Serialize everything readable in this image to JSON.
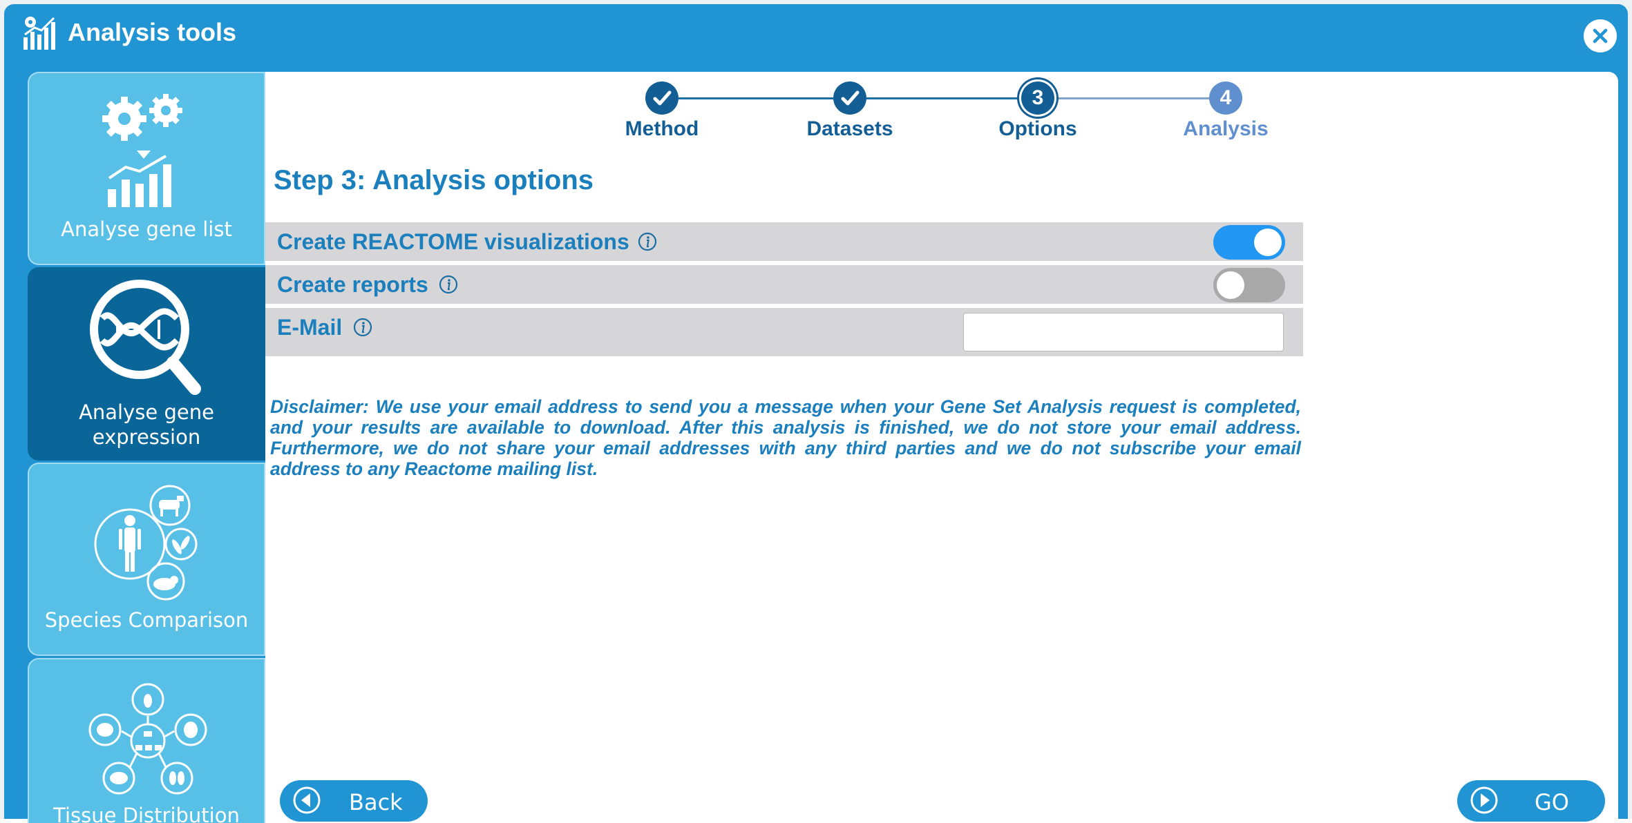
{
  "window": {
    "title": "Analysis tools",
    "logo_icon": "chart-logo-icon",
    "close_icon": "close-icon"
  },
  "colors": {
    "accent": "#2195d3",
    "sidebar_inactive": "#58c0e6",
    "sidebar_active": "#0a6599",
    "text_blue": "#1b7fbd",
    "toggle_on": "#2196f3",
    "toggle_off": "#a9a9a9"
  },
  "sidebar": {
    "items": [
      {
        "label": "Analyse gene list",
        "icon": "gears-chart-icon",
        "active": false
      },
      {
        "label_line1": "Analyse gene",
        "label_line2": "expression",
        "icon": "dna-magnifier-icon",
        "active": true
      },
      {
        "label": "Species Comparison",
        "icon": "species-icon",
        "active": false
      },
      {
        "label": "Tissue Distribution",
        "icon": "tissue-network-icon",
        "active": false
      }
    ]
  },
  "stepper": {
    "steps": [
      {
        "number": "1",
        "label": "Method",
        "state": "done"
      },
      {
        "number": "2",
        "label": "Datasets",
        "state": "done"
      },
      {
        "number": "3",
        "label": "Options",
        "state": "current"
      },
      {
        "number": "4",
        "label": "Analysis",
        "state": "upcoming"
      }
    ]
  },
  "main": {
    "title": "Step 3: Analysis options",
    "options": {
      "reactome": {
        "label": "Create REACTOME visualizations",
        "enabled": true
      },
      "reports": {
        "label": "Create reports",
        "enabled": false
      },
      "email": {
        "label": "E-Mail",
        "value": "",
        "placeholder": ""
      }
    },
    "disclaimer": "Disclaimer: We use your email address to send you a message when your Gene Set Analysis request is completed, and your results are available to download. After this analysis is finished, we do not store your email address. Furthermore, we do not share your email addresses with any third parties and we do not subscribe your email address to any Reactome mailing list."
  },
  "buttons": {
    "back": "Back",
    "go": "GO"
  }
}
